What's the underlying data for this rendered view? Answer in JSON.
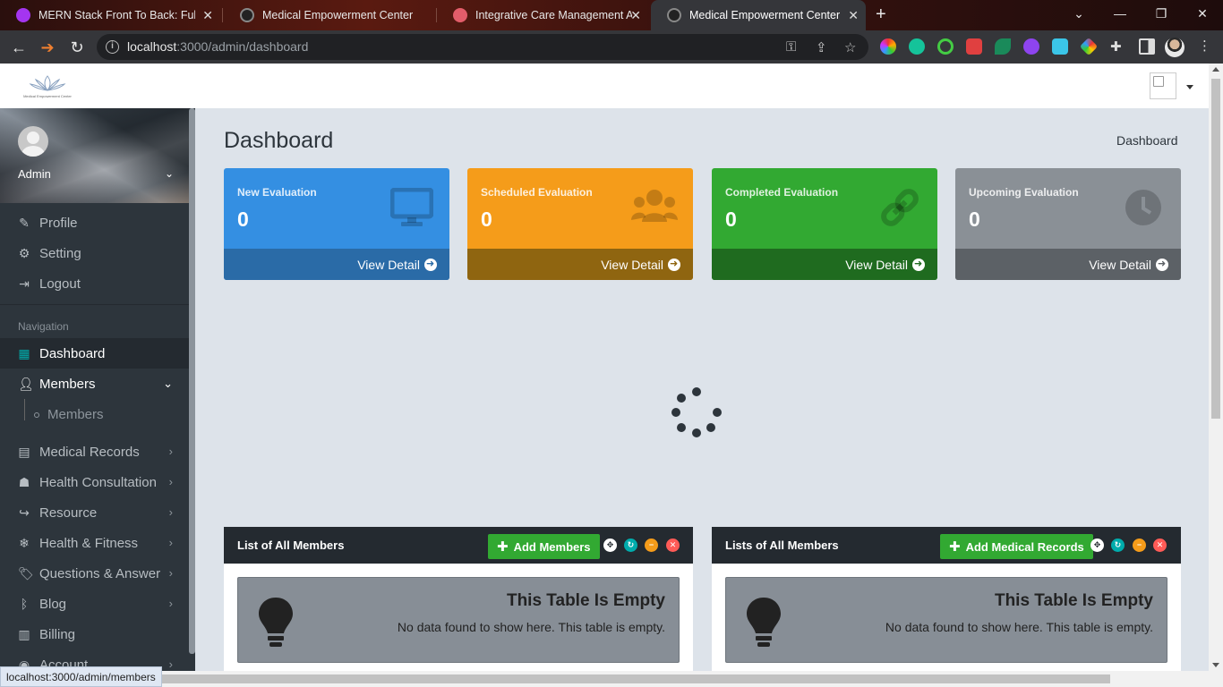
{
  "browser": {
    "tabs": [
      {
        "title": "MERN Stack Front To Back: Full St",
        "active": false
      },
      {
        "title": "Medical Empowerment Center",
        "active": false
      },
      {
        "title": "Integrative Care Management Ap",
        "active": false
      },
      {
        "title": "Medical Empowerment Center",
        "active": true
      }
    ],
    "url_host": "localhost",
    "url_path": ":3000/admin/dashboard",
    "status_url": "localhost:3000/admin/members"
  },
  "header": {
    "logo_text": "Medical Empowerment Center"
  },
  "sidebar": {
    "user_name": "Admin",
    "profile_menu": [
      {
        "label": "Profile",
        "icon": "pencil-icon"
      },
      {
        "label": "Setting",
        "icon": "gear-icon"
      },
      {
        "label": "Logout",
        "icon": "sign-out-icon"
      }
    ],
    "nav_header": "Navigation",
    "items": [
      {
        "label": "Dashboard",
        "icon": "grid-icon"
      },
      {
        "label": "Members",
        "icon": "user-icon"
      },
      {
        "label": "Medical Records",
        "icon": "file-icon"
      },
      {
        "label": "Health Consultation",
        "icon": "user-secret-icon"
      },
      {
        "label": "Resource",
        "icon": "share-icon"
      },
      {
        "label": "Health & Fitness",
        "icon": "snowflake-icon"
      },
      {
        "label": "Questions & Answer",
        "icon": "tag-icon"
      },
      {
        "label": "Blog",
        "icon": "blog-icon"
      },
      {
        "label": "Billing",
        "icon": "billing-icon"
      },
      {
        "label": "Account",
        "icon": "account-icon"
      }
    ],
    "submenu_members": "Members"
  },
  "main": {
    "title": "Dashboard",
    "breadcrumb": "Dashboard",
    "stats": [
      {
        "label": "New Evaluation",
        "value": "0",
        "link": "View Detail",
        "color": "#348fe2",
        "foot_color": "#2a6ba7",
        "icon": "desktop-icon"
      },
      {
        "label": "Scheduled Evaluation",
        "value": "0",
        "link": "View Detail",
        "color": "#f59c1a",
        "foot_color": "#8f6510",
        "icon": "users-icon"
      },
      {
        "label": "Completed Evaluation",
        "value": "0",
        "link": "View Detail",
        "color": "#32a932",
        "foot_color": "#1f6b1f",
        "icon": "link-icon"
      },
      {
        "label": "Upcoming Evaluation",
        "value": "0",
        "link": "View Detail",
        "color": "#8a9096",
        "foot_color": "#5c6166",
        "icon": "clock-icon"
      }
    ],
    "panels": [
      {
        "title": "List of All Members",
        "button": "Add Members",
        "empty_title": "This Table Is Empty",
        "empty_text": "No data found to show here. This table is empty."
      },
      {
        "title": "Lists of All Members",
        "button": "Add Medical Records",
        "empty_title": "This Table Is Empty",
        "empty_text": "No data found to show here. This table is empty."
      }
    ]
  }
}
